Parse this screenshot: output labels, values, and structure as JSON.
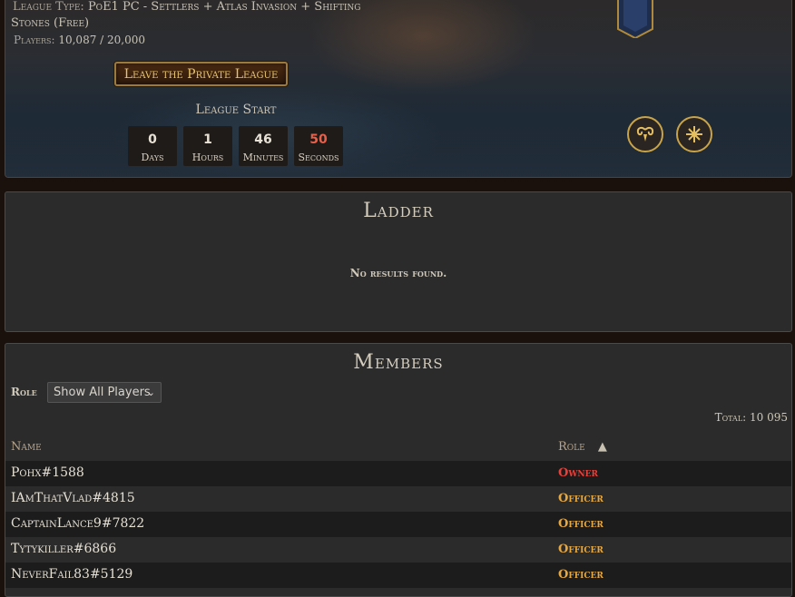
{
  "league": {
    "type_label": "League Type:",
    "type_value_line1": "PoE1 PC - Settlers + Atlas Invasion + Shifting",
    "type_value_line2": "Stones (Free)",
    "players_label": "Players:",
    "players_value": "10,087 / 20,000",
    "leave_button": "Leave the Private League",
    "start_label": "League Start",
    "countdown": [
      {
        "value": "0",
        "unit": "Days"
      },
      {
        "value": "1",
        "unit": "Hours"
      },
      {
        "value": "46",
        "unit": "Minutes"
      },
      {
        "value": "50",
        "unit": "Seconds"
      }
    ]
  },
  "ladder": {
    "title": "Ladder",
    "empty_message": "No results found."
  },
  "members": {
    "title": "Members",
    "role_filter_label": "Role",
    "role_filter_value": "Show All Players",
    "total": "Total: 10 095",
    "columns": {
      "name": "Name",
      "role": "Role",
      "sort_indicator": "▲"
    },
    "rows": [
      {
        "name": "Pohx#1588",
        "role": "Owner"
      },
      {
        "name": "IAmThatVlad#4815",
        "role": "Officer"
      },
      {
        "name": "CaptainLance9#7822",
        "role": "Officer"
      },
      {
        "name": "Tytykiller#6866",
        "role": "Officer"
      },
      {
        "name": "NeverFail83#5129",
        "role": "Officer"
      }
    ]
  },
  "colors": {
    "owner": "#e8403a",
    "officer": "#e8a840",
    "accent_gold": "#c9a448"
  },
  "icons": {
    "emblem_left": "ram-horns-icon",
    "emblem_right": "snowflake-cross-icon",
    "banner": "guild-banner-icon"
  }
}
